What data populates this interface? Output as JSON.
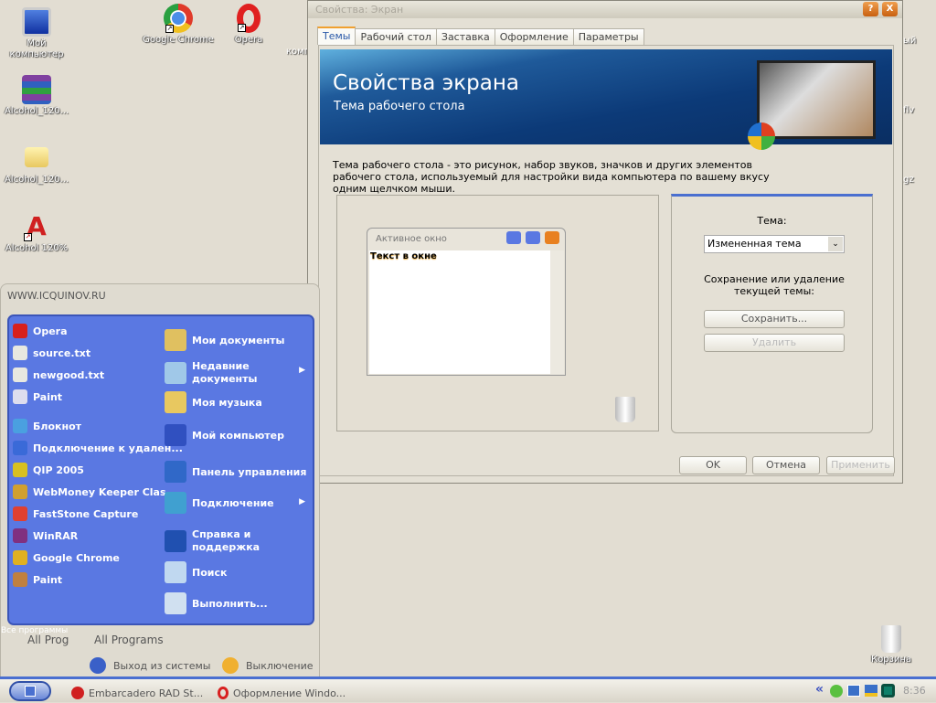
{
  "desktop": {
    "icons": [
      {
        "label": "Мой компьютер",
        "icon": "my-computer-icon"
      },
      {
        "label": "Google Chrome",
        "icon": "chrome-icon"
      },
      {
        "label": "Opera",
        "icon": "opera-icon"
      },
      {
        "label": "Alcohol_120...",
        "icon": "winrar-archive-icon"
      },
      {
        "label": "Alcohol_120...",
        "icon": "folder-icon"
      },
      {
        "label": "Alcohol 120%",
        "icon": "alcohol-icon"
      },
      {
        "label": "Корзина",
        "icon": "recycle-bin-icon"
      }
    ],
    "partial_labels": [
      "комп",
      "ый",
      "flv",
      ".gz"
    ]
  },
  "dialog": {
    "title": "Свойства: Экран",
    "help": "?",
    "close": "X",
    "tabs": [
      "Темы",
      "Рабочий стол",
      "Заставка",
      "Оформление",
      "Параметры"
    ],
    "banner_title": "Свойства экрана",
    "banner_subtitle": "Тема рабочего стола",
    "description": "Тема рабочего стола - это рисунок, набор звуков, значков и других элементов рабочего стола, используемый для настройки вида компьютера по вашему вкусу одним щелчком мыши.",
    "preview": {
      "window_title": "Активное окно",
      "window_text": "Текст в окне"
    },
    "theme_label": "Тема:",
    "theme_value": "Измененная тема",
    "save_delete_text": "Сохранение или удаление текущей темы:",
    "save": "Сохранить...",
    "delete": "Удалить",
    "ok": "OK",
    "cancel": "Отмена",
    "apply": "Применить"
  },
  "start_menu": {
    "header": "WWW.ICQUINOV.RU",
    "left": [
      {
        "label": "Opera",
        "icon": "opera-icon",
        "color": "#d8201c"
      },
      {
        "label": "source.txt",
        "icon": "text-file-icon",
        "color": "#e8e8e0"
      },
      {
        "label": "newgood.txt",
        "icon": "text-file-icon",
        "color": "#e8e8e0"
      },
      {
        "label": "Paint",
        "icon": "paint-icon",
        "color": "#dde"
      },
      {
        "label": "Блокнот",
        "icon": "notepad-icon",
        "color": "#4aa0e0"
      },
      {
        "label": "Подключение к удален...",
        "icon": "remote-desktop-icon",
        "color": "#3a6ad8"
      },
      {
        "label": "QIP 2005",
        "icon": "qip-icon",
        "color": "#d8c020"
      },
      {
        "label": "WebMoney Keeper Clas...",
        "icon": "webmoney-icon",
        "color": "#d0a030"
      },
      {
        "label": "FastStone Capture",
        "icon": "faststone-icon",
        "color": "#e04030"
      },
      {
        "label": "WinRAR",
        "icon": "winrar-icon",
        "color": "#803080"
      },
      {
        "label": "Google Chrome",
        "icon": "chrome-icon",
        "color": "#e0b020"
      },
      {
        "label": "Paint",
        "icon": "paint-brushes-icon",
        "color": "#c08040"
      }
    ],
    "right": [
      {
        "label": "Мои документы",
        "icon": "my-documents-icon",
        "color": "#e0c060"
      },
      {
        "label": "Недавние документы",
        "icon": "recent-documents-icon",
        "color": "#a0c8e8"
      },
      {
        "label": "Моя музыка",
        "icon": "my-music-icon",
        "color": "#e8c860"
      },
      {
        "label": "Мой компьютер",
        "icon": "my-computer-icon",
        "color": "#3050c0"
      },
      {
        "label": "Панель управления",
        "icon": "control-panel-icon",
        "color": "#3068c8"
      },
      {
        "label": "Подключение",
        "icon": "network-icon",
        "color": "#40a0d0"
      },
      {
        "label": "Справка и поддержка",
        "icon": "help-icon",
        "color": "#2050b0"
      },
      {
        "label": "Поиск",
        "icon": "search-icon",
        "color": "#c0d8f0"
      },
      {
        "label": "Выполнить...",
        "icon": "run-icon",
        "color": "#d0e0f0"
      }
    ],
    "all_programs_overlay": "Все программы",
    "all_programs_short": "All Prog",
    "all_programs": "All Programs",
    "logoff": "Выход из системы",
    "shutdown": "Выключение"
  },
  "taskbar": {
    "items": [
      {
        "label": "Embarcadero RAD St...",
        "icon": "embarcadero-icon"
      },
      {
        "label": "Оформление Windo...",
        "icon": "opera-icon"
      }
    ],
    "tray_icons": [
      "show-hidden-icon",
      "icq-icon",
      "network-icon",
      "network-warning-icon",
      "tray-app-icon"
    ],
    "clock": "8:36"
  }
}
